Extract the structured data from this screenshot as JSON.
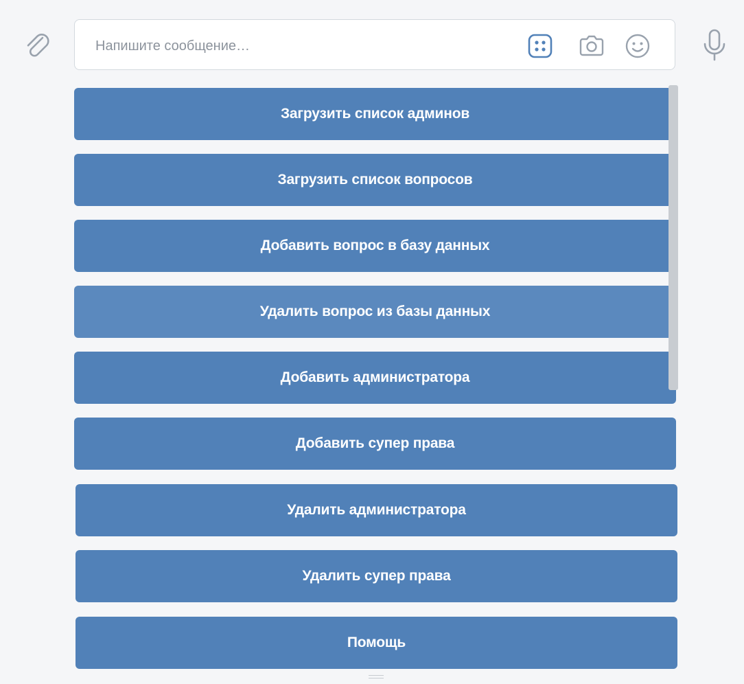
{
  "composer": {
    "placeholder": "Напишите сообщение…",
    "value": "",
    "icons": {
      "attach": "paperclip-icon",
      "keyboard": "keyboard-grid-icon",
      "camera": "camera-icon",
      "emoji": "smiley-icon",
      "mic": "microphone-icon"
    },
    "keyboard_toggle_active": true
  },
  "keyboard": {
    "buttons": [
      {
        "label": "Загрузить список админов"
      },
      {
        "label": "Загрузить список вопросов"
      },
      {
        "label": "Добавить вопрос в базу данных"
      },
      {
        "label": "Удалить вопрос из базы данных"
      },
      {
        "label": "Добавить администратора"
      },
      {
        "label": "Добавить супер права"
      },
      {
        "label": "Удалить администратора"
      },
      {
        "label": "Удалить супер права"
      },
      {
        "label": "Помощь"
      }
    ],
    "hovered_index": 3
  },
  "colors": {
    "background": "#f5f6f8",
    "button": "#5181b8",
    "button_hover": "#5b89be",
    "button_text": "#ffffff",
    "accent": "#5181b8",
    "icon_gray": "#99a2ad",
    "placeholder": "#8c939c"
  }
}
